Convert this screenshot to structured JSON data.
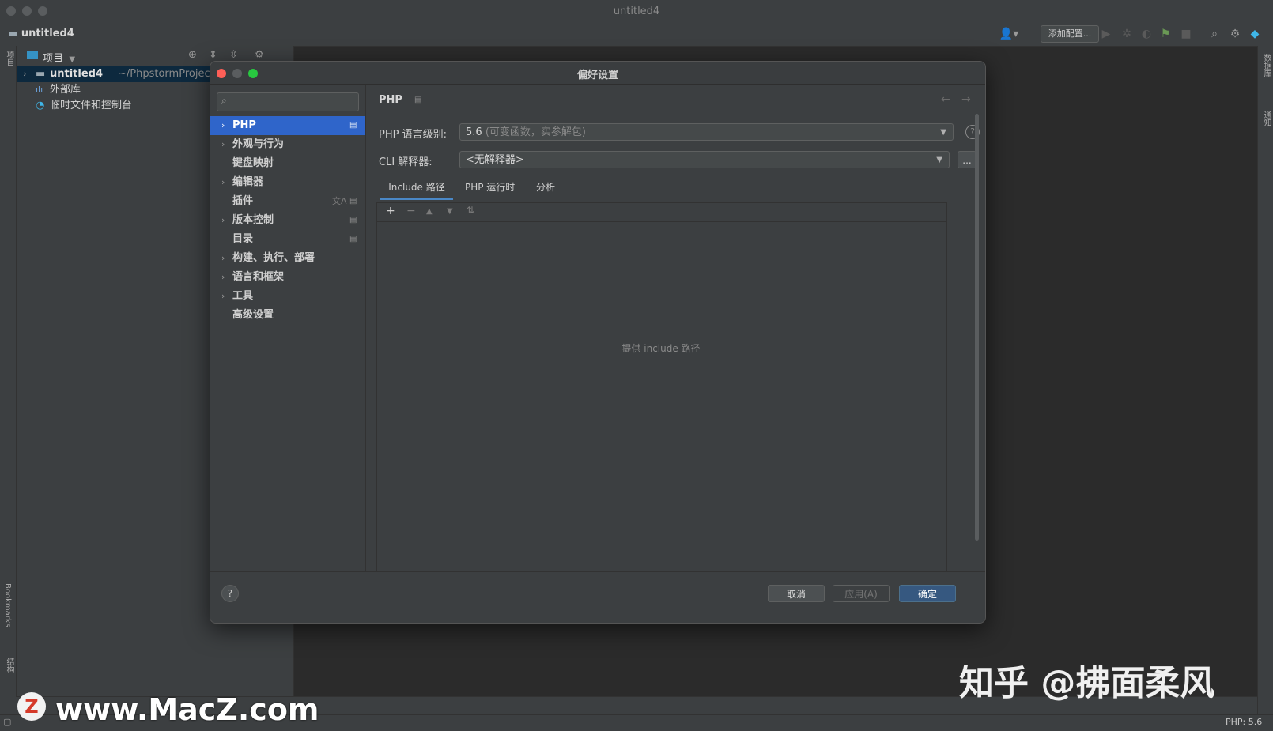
{
  "window": {
    "title": "untitled4"
  },
  "toolbar": {
    "breadcrumb": "untitled4",
    "add_config_label": "添加配置..."
  },
  "left_stripe": {
    "project_label": "项目",
    "bookmarks_label": "Bookmarks",
    "structure_label": "结构"
  },
  "right_stripe": {
    "database_label": "数据库",
    "notifications_label": "通知"
  },
  "project_panel": {
    "title": "项目",
    "tree": [
      {
        "label": "untitled4",
        "path": "~/PhpstormProjects/u"
      },
      {
        "label": "外部库"
      },
      {
        "label": "临时文件和控制台"
      }
    ]
  },
  "status": {
    "php_version": "PHP: 5.6"
  },
  "dialog": {
    "title": "偏好设置",
    "nav": [
      {
        "label": "PHP",
        "expandable": true,
        "selected": true
      },
      {
        "label": "外观与行为",
        "expandable": true
      },
      {
        "label": "键盘映射",
        "expandable": false
      },
      {
        "label": "编辑器",
        "expandable": true
      },
      {
        "label": "插件",
        "expandable": false
      },
      {
        "label": "版本控制",
        "expandable": true
      },
      {
        "label": "目录",
        "expandable": false
      },
      {
        "label": "构建、执行、部署",
        "expandable": true
      },
      {
        "label": "语言和框架",
        "expandable": true
      },
      {
        "label": "工具",
        "expandable": true
      },
      {
        "label": "高级设置",
        "expandable": false
      }
    ],
    "content": {
      "heading": "PHP",
      "php_level_label": "PHP 语言级别:",
      "php_level_value": "5.6",
      "php_level_hint": "(可变函数，实参解包)",
      "cli_label": "CLI 解释器:",
      "cli_value": "<无解释器>",
      "browse_label": "...",
      "tabs": [
        "Include 路径",
        "PHP 运行时",
        "分析"
      ],
      "active_tab": 0,
      "empty_text": "提供 include 路径"
    },
    "footer": {
      "cancel_label": "取消",
      "apply_label": "应用(A)",
      "ok_label": "确定"
    }
  },
  "watermarks": {
    "zhihu": "知乎 @拂面柔风",
    "site": "www.MacZ.com",
    "site_logo": "Z"
  },
  "colors": {
    "selection": "#2f65ca",
    "primary_button": "#365880",
    "close": "#ff5f57",
    "minimize": "#febc2e",
    "zoom": "#28c840"
  }
}
